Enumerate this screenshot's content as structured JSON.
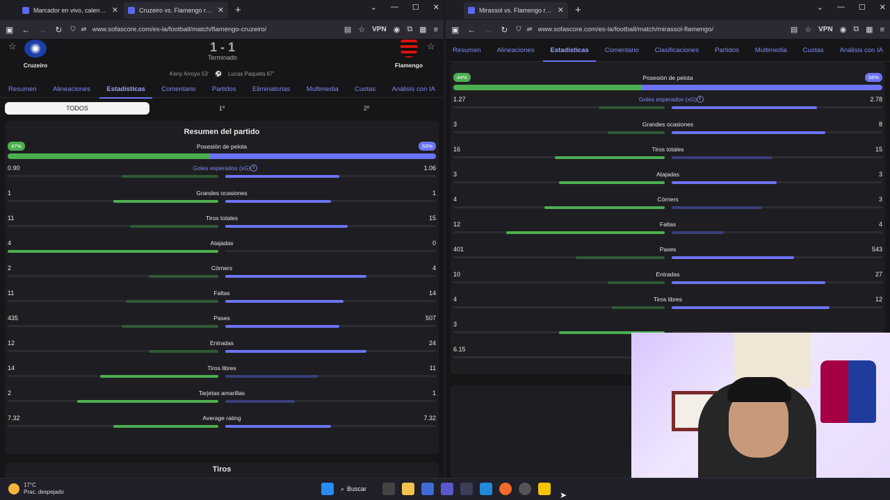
{
  "left_window": {
    "tabs": [
      "Marcador en vivo, calendario y",
      "Cruzeiro vs. Flamengo resultad"
    ],
    "url": "www.sofascore.com/es-la/football/match/flamengo-cruzeiro/",
    "vpn": "VPN",
    "home_team": "Cruzeiro",
    "away_team": "Flamengo",
    "score": "1 - 1",
    "status": "Terminado",
    "scorer_home": "Keny Arroyo 53'",
    "scorer_away": "Lucas Paquetá 67'",
    "nav_tabs": [
      "Resumen",
      "Alineaciones",
      "Estadísticas",
      "Comentario",
      "Partidos",
      "Eliminatorias",
      "Multimedia",
      "Cuotas",
      "Análisis con IA"
    ],
    "periods": [
      "TODOS",
      "1º",
      "2º"
    ],
    "card_title": "Resumen del partido",
    "possession": {
      "label": "Posesión de pelota",
      "home": "47%",
      "away": "53%",
      "home_pct": 47
    },
    "stats": [
      {
        "label": "Goles esperados (xG)",
        "home": "0.90",
        "away": "1.06",
        "hf": 0.46,
        "af": 0.54,
        "link": true
      },
      {
        "label": "Grandes ocasiones",
        "home": "1",
        "away": "1",
        "hf": 0.5,
        "af": 0.5
      },
      {
        "label": "Tiros totales",
        "home": "11",
        "away": "15",
        "hf": 0.42,
        "af": 0.58
      },
      {
        "label": "Atajadas",
        "home": "4",
        "away": "0",
        "hf": 1.0,
        "af": 0
      },
      {
        "label": "Córners",
        "home": "2",
        "away": "4",
        "hf": 0.33,
        "af": 0.67
      },
      {
        "label": "Faltas",
        "home": "11",
        "away": "14",
        "hf": 0.44,
        "af": 0.56
      },
      {
        "label": "Pases",
        "home": "435",
        "away": "507",
        "hf": 0.46,
        "af": 0.54
      },
      {
        "label": "Entradas",
        "home": "12",
        "away": "24",
        "hf": 0.33,
        "af": 0.67
      },
      {
        "label": "Tiros libres",
        "home": "14",
        "away": "11",
        "hf": 0.56,
        "af": 0.44
      },
      {
        "label": "Tarjetas amarillas",
        "home": "2",
        "away": "1",
        "hf": 0.67,
        "af": 0.33
      },
      {
        "label": "Average rating",
        "home": "7.32",
        "away": "7.32",
        "hf": 0.5,
        "af": 0.5
      }
    ],
    "next_section": "Tiros"
  },
  "right_window": {
    "tabs": [
      "Mirassol vs. Flamengo resultad"
    ],
    "url": "www.sofascore.com/es-la/football/match/mirassol-flamengo/",
    "vpn": "VPN",
    "nav_tabs": [
      "Resumen",
      "Alineaciones",
      "Estadísticas",
      "Comentario",
      "Clasificaciones",
      "Partidos",
      "Multimedia",
      "Cuotas",
      "Análisis con IA"
    ],
    "possession": {
      "label": "Posesión de pelota",
      "home": "44%",
      "away": "56%",
      "home_pct": 44
    },
    "stats": [
      {
        "label": "Goles esperados (xG)",
        "home": "1.27",
        "away": "2.78",
        "hf": 0.31,
        "af": 0.69,
        "link": true
      },
      {
        "label": "Grandes ocasiones",
        "home": "3",
        "away": "8",
        "hf": 0.27,
        "af": 0.73
      },
      {
        "label": "Tiros totales",
        "home": "16",
        "away": "15",
        "hf": 0.52,
        "af": 0.48
      },
      {
        "label": "Atajadas",
        "home": "3",
        "away": "3",
        "hf": 0.5,
        "af": 0.5
      },
      {
        "label": "Córners",
        "home": "4",
        "away": "3",
        "hf": 0.57,
        "af": 0.43
      },
      {
        "label": "Faltas",
        "home": "12",
        "away": "4",
        "hf": 0.75,
        "af": 0.25
      },
      {
        "label": "Pases",
        "home": "401",
        "away": "543",
        "hf": 0.42,
        "af": 0.58
      },
      {
        "label": "Entradas",
        "home": "10",
        "away": "27",
        "hf": 0.27,
        "af": 0.73
      },
      {
        "label": "Tiros libres",
        "home": "4",
        "away": "12",
        "hf": 0.25,
        "af": 0.75
      },
      {
        "label": "",
        "home": "3",
        "away": "",
        "hf": 0.5,
        "af": 0
      },
      {
        "label": "",
        "home": "6.15",
        "away": "",
        "hf": 0,
        "af": 0
      }
    ]
  },
  "taskbar": {
    "temp": "17°C",
    "weather": "Prac. despejado",
    "search": "Buscar"
  },
  "colors": {
    "home": "#4caf50",
    "away": "#6c74f4"
  }
}
